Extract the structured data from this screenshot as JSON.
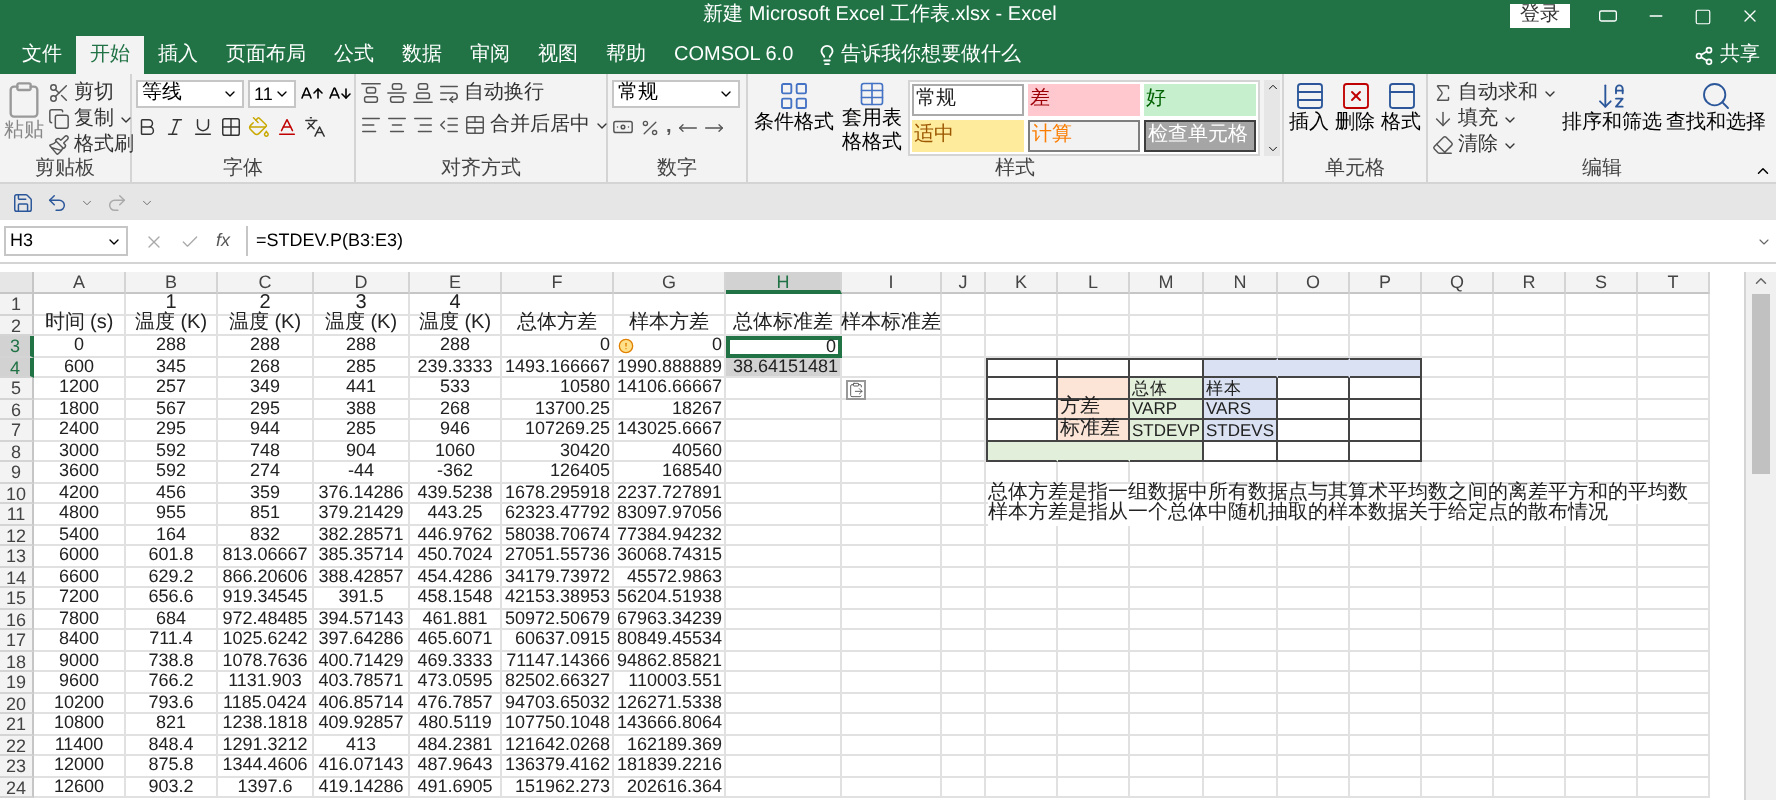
{
  "window": {
    "title": "新建 Microsoft Excel 工作表.xlsx - Excel",
    "sign_in": "登录"
  },
  "tabs": [
    {
      "label": "文件",
      "selected": false
    },
    {
      "label": "开始",
      "selected": true
    },
    {
      "label": "插入",
      "selected": false
    },
    {
      "label": "页面布局",
      "selected": false
    },
    {
      "label": "公式",
      "selected": false
    },
    {
      "label": "数据",
      "selected": false
    },
    {
      "label": "审阅",
      "selected": false
    },
    {
      "label": "视图",
      "selected": false
    },
    {
      "label": "帮助",
      "selected": false
    },
    {
      "label": "COMSOL 6.0",
      "selected": false
    }
  ],
  "tell_me": "告诉我你想要做什么",
  "share": "共享",
  "ribbon": {
    "clipboard": {
      "paste": "粘贴",
      "cut": "剪切",
      "copy": "复制",
      "format_painter": "格式刷",
      "label": "剪贴板"
    },
    "font": {
      "font_name": "等线",
      "font_size": "11",
      "label": "字体"
    },
    "alignment": {
      "wrap": "自动换行",
      "merge": "合并后居中",
      "label": "对齐方式"
    },
    "number": {
      "format": "常规",
      "comma": ",",
      "label": "数字"
    },
    "styles": {
      "conditional": "条件格式",
      "table": "套用表格格式",
      "label": "样式",
      "gallery": [
        {
          "label": "常规",
          "kind": "normal"
        },
        {
          "label": "差",
          "kind": "bad"
        },
        {
          "label": "好",
          "kind": "good"
        },
        {
          "label": "适中",
          "kind": "neutral"
        },
        {
          "label": "计算",
          "kind": "calculation"
        },
        {
          "label": "检查单元格",
          "kind": "check"
        }
      ]
    },
    "cells": {
      "label": "单元格",
      "buttons": [
        {
          "label": "插入",
          "kind": "insert"
        },
        {
          "label": "删除",
          "kind": "delete"
        },
        {
          "label": "格式",
          "kind": "format"
        }
      ]
    },
    "editing": {
      "autosum": "自动求和",
      "fill": "填充",
      "clear": "清除",
      "sort": "排序和筛选",
      "find": "查找和选择",
      "label": "编辑"
    }
  },
  "formula_bar": {
    "name_box": "H3",
    "function_symbol": "fx",
    "formula": "=STDEV.P(B3:E3)"
  },
  "sheet": {
    "columns": [
      {
        "label": "A",
        "selected": false
      },
      {
        "label": "B",
        "selected": false
      },
      {
        "label": "C",
        "selected": false
      },
      {
        "label": "D",
        "selected": false
      },
      {
        "label": "E",
        "selected": false
      },
      {
        "label": "F",
        "selected": false
      },
      {
        "label": "G",
        "selected": false
      },
      {
        "label": "H",
        "selected": true
      },
      {
        "label": "I",
        "selected": false
      },
      {
        "label": "J",
        "selected": false
      },
      {
        "label": "K",
        "selected": false
      },
      {
        "label": "L",
        "selected": false
      },
      {
        "label": "M",
        "selected": false
      },
      {
        "label": "N",
        "selected": false
      },
      {
        "label": "O",
        "selected": false
      },
      {
        "label": "P",
        "selected": false
      },
      {
        "label": "Q",
        "selected": false
      },
      {
        "label": "R",
        "selected": false
      },
      {
        "label": "S",
        "selected": false
      },
      {
        "label": "T",
        "selected": false
      }
    ],
    "rows": [
      {
        "label": "1",
        "selected": false,
        "kind": "label",
        "cells": [
          "",
          "1",
          "2",
          "3",
          "4"
        ]
      },
      {
        "label": "2",
        "selected": false,
        "kind": "label",
        "cells": [
          "时间 (s)",
          "温度 (K)",
          "温度 (K)",
          "温度 (K)",
          "温度 (K)",
          "总体方差",
          "样本方差",
          "总体标准差",
          "样本标准差"
        ]
      },
      {
        "label": "3",
        "selected": true,
        "kind": "data",
        "cells": [
          "0",
          "288",
          "288",
          "288",
          "288",
          "0",
          "0",
          "0"
        ]
      },
      {
        "label": "4",
        "selected": true,
        "kind": "data",
        "cells": [
          "600",
          "345",
          "268",
          "285",
          "239.3333",
          "1493.166667",
          "1990.888889",
          "38.64151481"
        ]
      },
      {
        "label": "5",
        "selected": false,
        "kind": "data",
        "cells": [
          "1200",
          "257",
          "349",
          "441",
          "533",
          "10580",
          "14106.66667"
        ]
      },
      {
        "label": "6",
        "selected": false,
        "kind": "data",
        "cells": [
          "1800",
          "567",
          "295",
          "388",
          "268",
          "13700.25",
          "18267"
        ]
      },
      {
        "label": "7",
        "selected": false,
        "kind": "data",
        "cells": [
          "2400",
          "295",
          "944",
          "285",
          "946",
          "107269.25",
          "143025.6667"
        ]
      },
      {
        "label": "8",
        "selected": false,
        "kind": "data",
        "cells": [
          "3000",
          "592",
          "748",
          "904",
          "1060",
          "30420",
          "40560"
        ]
      },
      {
        "label": "9",
        "selected": false,
        "kind": "data",
        "cells": [
          "3600",
          "592",
          "274",
          "-44",
          "-362",
          "126405",
          "168540"
        ]
      },
      {
        "label": "10",
        "selected": false,
        "kind": "data",
        "cells": [
          "4200",
          "456",
          "359",
          "376.14286",
          "439.5238",
          "1678.295918",
          "2237.727891"
        ]
      },
      {
        "label": "11",
        "selected": false,
        "kind": "data",
        "cells": [
          "4800",
          "955",
          "851",
          "379.21429",
          "443.25",
          "62323.47792",
          "83097.97056"
        ]
      },
      {
        "label": "12",
        "selected": false,
        "kind": "data",
        "cells": [
          "5400",
          "164",
          "832",
          "382.28571",
          "446.9762",
          "58038.70674",
          "77384.94232"
        ]
      },
      {
        "label": "13",
        "selected": false,
        "kind": "data",
        "cells": [
          "6000",
          "601.8",
          "813.06667",
          "385.35714",
          "450.7024",
          "27051.55736",
          "36068.74315"
        ]
      },
      {
        "label": "14",
        "selected": false,
        "kind": "data",
        "cells": [
          "6600",
          "629.2",
          "866.20606",
          "388.42857",
          "454.4286",
          "34179.73972",
          "45572.9863"
        ]
      },
      {
        "label": "15",
        "selected": false,
        "kind": "data",
        "cells": [
          "7200",
          "656.6",
          "919.34545",
          "391.5",
          "458.1548",
          "42153.38953",
          "56204.51938"
        ]
      },
      {
        "label": "16",
        "selected": false,
        "kind": "data",
        "cells": [
          "7800",
          "684",
          "972.48485",
          "394.57143",
          "461.881",
          "50972.50679",
          "67963.34239"
        ]
      },
      {
        "label": "17",
        "selected": false,
        "kind": "data",
        "cells": [
          "8400",
          "711.4",
          "1025.6242",
          "397.64286",
          "465.6071",
          "60637.0915",
          "80849.45534"
        ]
      },
      {
        "label": "18",
        "selected": false,
        "kind": "data",
        "cells": [
          "9000",
          "738.8",
          "1078.7636",
          "400.71429",
          "469.3333",
          "71147.14366",
          "94862.85821"
        ]
      },
      {
        "label": "19",
        "selected": false,
        "kind": "data",
        "cells": [
          "9600",
          "766.2",
          "1131.903",
          "403.78571",
          "473.0595",
          "82502.66327",
          "110003.551"
        ]
      },
      {
        "label": "20",
        "selected": false,
        "kind": "data",
        "cells": [
          "10200",
          "793.6",
          "1185.0424",
          "406.85714",
          "476.7857",
          "94703.65032",
          "126271.5338"
        ]
      },
      {
        "label": "21",
        "selected": false,
        "kind": "data",
        "cells": [
          "10800",
          "821",
          "1238.1818",
          "409.92857",
          "480.5119",
          "107750.1048",
          "143666.8064"
        ]
      },
      {
        "label": "22",
        "selected": false,
        "kind": "data",
        "cells": [
          "11400",
          "848.4",
          "1291.3212",
          "413",
          "484.2381",
          "121642.0268",
          "162189.369"
        ]
      },
      {
        "label": "23",
        "selected": false,
        "kind": "data",
        "cells": [
          "12000",
          "875.8",
          "1344.4606",
          "416.07143",
          "487.9643",
          "136379.4162",
          "181839.2216"
        ]
      },
      {
        "label": "24",
        "selected": false,
        "kind": "data",
        "cells": [
          "12600",
          "903.2",
          "1397.6",
          "419.14286",
          "491.6905",
          "151962.273",
          "202616.364"
        ]
      }
    ],
    "table": [
      [
        {
          "kind": "blank"
        },
        {
          "kind": "blank"
        },
        {
          "kind": "blank"
        },
        {
          "kind": "shaded",
          "color": "#d9e1f2"
        },
        {
          "kind": "shaded",
          "color": "#d9e1f2"
        },
        {
          "kind": "shaded",
          "color": "#d9e1f2"
        }
      ],
      [
        {
          "kind": "blank"
        },
        {
          "kind": "shaded",
          "color": "#fce4d6"
        },
        {
          "kind": "shaded",
          "text": "总体",
          "color": "#e2efda"
        },
        {
          "kind": "shaded",
          "text": "样本",
          "color": "#d9e1f2"
        },
        {
          "kind": "blank"
        },
        {
          "kind": "blank"
        }
      ],
      [
        {
          "kind": "blank"
        },
        {
          "kind": "shaded",
          "text": "方差",
          "color": "#fce4d6"
        },
        {
          "kind": "shaded",
          "text": "VARP",
          "color": "#e2efda"
        },
        {
          "kind": "shaded",
          "text": "VARS",
          "color": "#d9e1f2"
        },
        {
          "kind": "blank"
        },
        {
          "kind": "blank"
        }
      ],
      [
        {
          "kind": "blank"
        },
        {
          "kind": "shaded",
          "text": "标准差",
          "color": "#fce4d6"
        },
        {
          "kind": "shaded",
          "text": "STDEVP",
          "color": "#e2efda"
        },
        {
          "kind": "shaded",
          "text": "STDEVS",
          "color": "#d9e1f2"
        },
        {
          "kind": "blank"
        },
        {
          "kind": "blank"
        }
      ],
      [
        {
          "kind": "shaded",
          "color": "#e2efda"
        },
        {
          "kind": "shaded",
          "color": "#e2efda"
        },
        {
          "kind": "shaded",
          "color": "#e2efda"
        },
        {
          "kind": "blank"
        },
        {
          "kind": "blank"
        },
        {
          "kind": "blank"
        }
      ]
    ],
    "notes": [
      "总体方差是指一组数据中所有数据点与其算术平均数之间的离差平方和的平均数",
      "样本方差是指从一个总体中随机抽取的样本数据关于给定点的散布情况"
    ]
  }
}
